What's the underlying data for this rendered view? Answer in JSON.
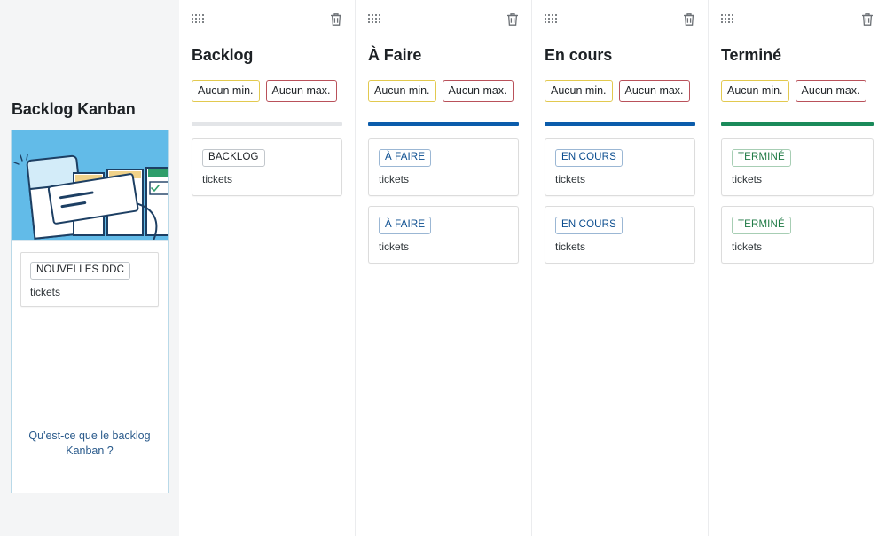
{
  "sidebar": {
    "title": "Backlog Kanban",
    "illustration_name": "kanban-board-illustration",
    "illustration_bg": "#62bbe8",
    "card": {
      "tag": "NOUVELLES DDC",
      "subtitle": "tickets"
    },
    "link": "Qu'est-ce que le backlog Kanban ?"
  },
  "columns": [
    {
      "title": "Backlog",
      "min_label": "Aucun min.",
      "max_label": "Aucun max.",
      "bar_color": "#e3e5e8",
      "chip_style": "chip-neutral",
      "cards": [
        {
          "tag": "BACKLOG",
          "subtitle": "tickets"
        }
      ]
    },
    {
      "title": "À Faire",
      "min_label": "Aucun min.",
      "max_label": "Aucun max.",
      "bar_color": "#0b5cab",
      "chip_style": "chip-blue",
      "cards": [
        {
          "tag": "À FAIRE",
          "subtitle": "tickets"
        },
        {
          "tag": "À FAIRE",
          "subtitle": "tickets"
        }
      ]
    },
    {
      "title": "En cours",
      "min_label": "Aucun min.",
      "max_label": "Aucun max.",
      "bar_color": "#0b5cab",
      "chip_style": "chip-blue",
      "cards": [
        {
          "tag": "EN COURS",
          "subtitle": "tickets"
        },
        {
          "tag": "EN COURS",
          "subtitle": "tickets"
        }
      ]
    },
    {
      "title": "Terminé",
      "min_label": "Aucun min.",
      "max_label": "Aucun max.",
      "bar_color": "#1a8a5a",
      "chip_style": "chip-green",
      "cards": [
        {
          "tag": "TERMINÉ",
          "subtitle": "tickets"
        },
        {
          "tag": "TERMINÉ",
          "subtitle": "tickets"
        }
      ]
    }
  ],
  "icons": {
    "drag_handle": "drag-handle-icon",
    "trash": "trash-icon"
  }
}
